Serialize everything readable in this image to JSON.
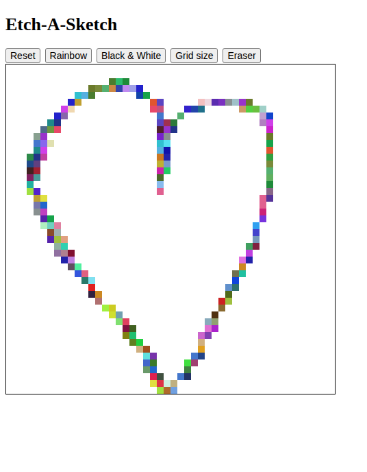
{
  "title": "Etch-A-Sketch",
  "buttons": [
    {
      "label": "Reset"
    },
    {
      "label": "Rainbow"
    },
    {
      "label": "Black & White"
    },
    {
      "label": "Grid size"
    },
    {
      "label": "Eraser"
    }
  ],
  "grid": {
    "cells": [
      [
        2,
        15,
        "#4a7c2f"
      ],
      [
        2,
        16,
        "#2dbb6e"
      ],
      [
        2,
        17,
        "#1f8a3a"
      ],
      [
        3,
        12,
        "#6b7a2a"
      ],
      [
        3,
        13,
        "#7a8a3a"
      ],
      [
        3,
        14,
        "#55b070"
      ],
      [
        3,
        15,
        "#cc8844"
      ],
      [
        3,
        16,
        "#3344aa"
      ],
      [
        3,
        17,
        "#c08af0"
      ],
      [
        3,
        18,
        "#a0a0e8"
      ],
      [
        3,
        19,
        "#2222cc"
      ],
      [
        4,
        10,
        "#30c0d0"
      ],
      [
        4,
        11,
        "#56b0e0"
      ],
      [
        4,
        12,
        "#4a7c2f"
      ],
      [
        4,
        19,
        "#1144aa"
      ],
      [
        4,
        20,
        "#16a34a"
      ],
      [
        5,
        9,
        "#2222cc"
      ],
      [
        5,
        10,
        "#c0a030"
      ],
      [
        5,
        21,
        "#e05530"
      ],
      [
        5,
        22,
        "#5b45c2"
      ],
      [
        5,
        28,
        "#f4c0c0"
      ],
      [
        5,
        29,
        "#f0d8e0"
      ],
      [
        5,
        30,
        "#5b2cb0"
      ],
      [
        5,
        31,
        "#7a30c0"
      ],
      [
        5,
        32,
        "#889090"
      ],
      [
        5,
        33,
        "#a0c0c8"
      ],
      [
        5,
        34,
        "#9933cc"
      ],
      [
        5,
        35,
        "#6b7a2a"
      ],
      [
        6,
        8,
        "#d040e8"
      ],
      [
        6,
        9,
        "#f0d8b0"
      ],
      [
        6,
        21,
        "#e84868"
      ],
      [
        6,
        22,
        "#c45080"
      ],
      [
        6,
        26,
        "#3322cc"
      ],
      [
        6,
        27,
        "#2244aa"
      ],
      [
        6,
        28,
        "#1f6f8a"
      ],
      [
        6,
        34,
        "#cc9966"
      ],
      [
        6,
        35,
        "#55d040"
      ],
      [
        6,
        36,
        "#6ac040"
      ],
      [
        6,
        37,
        "#a0d0c8"
      ],
      [
        7,
        7,
        "#2222cc"
      ],
      [
        7,
        8,
        "#8866aa"
      ],
      [
        7,
        22,
        "#4477cc"
      ],
      [
        7,
        25,
        "#55b070"
      ],
      [
        7,
        37,
        "#c0a0d0"
      ],
      [
        7,
        38,
        "#1144cc"
      ],
      [
        8,
        6,
        "#1f8a8a"
      ],
      [
        8,
        7,
        "#223388"
      ],
      [
        8,
        22,
        "#5b45c2"
      ],
      [
        8,
        23,
        "#a03050"
      ],
      [
        8,
        24,
        "#2d7a3a"
      ],
      [
        8,
        37,
        "#b080c0"
      ],
      [
        8,
        38,
        "#d040e8"
      ],
      [
        9,
        5,
        "#506a8a"
      ],
      [
        9,
        6,
        "#6b9a40"
      ],
      [
        9,
        7,
        "#e84868"
      ],
      [
        9,
        22,
        "#502030"
      ],
      [
        9,
        23,
        "#9933cc"
      ],
      [
        9,
        24,
        "#223388"
      ],
      [
        9,
        38,
        "#cc22cc"
      ],
      [
        10,
        4,
        "#88a090"
      ],
      [
        10,
        5,
        "#9933cc"
      ],
      [
        10,
        22,
        "#7722cc"
      ],
      [
        10,
        23,
        "#889090"
      ],
      [
        10,
        38,
        "#6b7a2a"
      ],
      [
        11,
        4,
        "#4477cc"
      ],
      [
        11,
        5,
        "#8866ee"
      ],
      [
        11,
        6,
        "#e0e0b0"
      ],
      [
        11,
        22,
        "#30c0d0"
      ],
      [
        11,
        23,
        "#56e0f0"
      ],
      [
        11,
        38,
        "#16a34a"
      ],
      [
        12,
        4,
        "#1f8a8a"
      ],
      [
        12,
        5,
        "#d040e8"
      ],
      [
        12,
        22,
        "#56b0e0"
      ],
      [
        12,
        23,
        "#1111aa"
      ],
      [
        12,
        38,
        "#e05530"
      ],
      [
        13,
        3,
        "#2d8a4a"
      ],
      [
        13,
        4,
        "#223388"
      ],
      [
        13,
        5,
        "#c040a0"
      ],
      [
        13,
        22,
        "#cc7722"
      ],
      [
        13,
        23,
        "#2222aa"
      ],
      [
        13,
        38,
        "#30a040"
      ],
      [
        14,
        3,
        "#1f4a8a"
      ],
      [
        14,
        4,
        "#604080"
      ],
      [
        14,
        22,
        "#c0b030"
      ],
      [
        14,
        23,
        "#7799cc"
      ],
      [
        14,
        38,
        "#7a8a3a"
      ],
      [
        15,
        3,
        "#402020"
      ],
      [
        15,
        4,
        "#a02030"
      ],
      [
        15,
        22,
        "#cc22aa"
      ],
      [
        15,
        23,
        "#22cc66"
      ],
      [
        15,
        38,
        "#55b070"
      ],
      [
        16,
        3,
        "#802060"
      ],
      [
        16,
        4,
        "#4a9a9a"
      ],
      [
        16,
        22,
        "#4a6a2a"
      ],
      [
        16,
        38,
        "#60b060"
      ],
      [
        17,
        3,
        "#20b0a0"
      ],
      [
        17,
        22,
        "#88bbee"
      ],
      [
        17,
        38,
        "#1f8a3a"
      ],
      [
        18,
        3,
        "#a0e040"
      ],
      [
        18,
        4,
        "#5522cc"
      ],
      [
        18,
        22,
        "#e06090"
      ],
      [
        18,
        38,
        "#886688"
      ],
      [
        19,
        4,
        "#c0a030"
      ],
      [
        19,
        5,
        "#e0e040"
      ],
      [
        19,
        37,
        "#e06090"
      ],
      [
        19,
        38,
        "#553399"
      ],
      [
        20,
        4,
        "#7777aa"
      ],
      [
        20,
        5,
        "#2266cc"
      ],
      [
        20,
        37,
        "#e06090"
      ],
      [
        21,
        4,
        "#889090"
      ],
      [
        21,
        5,
        "#c040c0"
      ],
      [
        21,
        37,
        "#cc2277"
      ],
      [
        22,
        5,
        "#5522aa"
      ],
      [
        22,
        6,
        "#16a34a"
      ],
      [
        22,
        37,
        "#7733dd"
      ],
      [
        23,
        5,
        "#b0f0c0"
      ],
      [
        23,
        6,
        "#70d0c0"
      ],
      [
        23,
        7,
        "#e080a0"
      ],
      [
        23,
        36,
        "#30a0f0"
      ],
      [
        24,
        6,
        "#8a4a2a"
      ],
      [
        24,
        7,
        "#a0b0b0"
      ],
      [
        24,
        36,
        "#4444cc"
      ],
      [
        25,
        6,
        "#5522aa"
      ],
      [
        25,
        7,
        "#a0c040"
      ],
      [
        25,
        8,
        "#e0a080"
      ],
      [
        25,
        36,
        "#7799bb"
      ],
      [
        26,
        7,
        "#90b0a0"
      ],
      [
        26,
        8,
        "#30d0b0"
      ],
      [
        26,
        35,
        "#40a060"
      ],
      [
        26,
        36,
        "#802040"
      ],
      [
        27,
        7,
        "#9070a0"
      ],
      [
        27,
        8,
        "#b08090"
      ],
      [
        27,
        9,
        "#801030"
      ],
      [
        27,
        35,
        "#c040e0"
      ],
      [
        28,
        8,
        "#2222aa"
      ],
      [
        28,
        9,
        "#c080e0"
      ],
      [
        28,
        34,
        "#e070e0"
      ],
      [
        28,
        35,
        "#2222aa"
      ],
      [
        29,
        9,
        "#605060"
      ],
      [
        29,
        10,
        "#50f0a0"
      ],
      [
        29,
        34,
        "#cc8822"
      ],
      [
        30,
        10,
        "#3355dd"
      ],
      [
        30,
        11,
        "#e06080"
      ],
      [
        30,
        33,
        "#707050"
      ],
      [
        30,
        34,
        "#20c0a0"
      ],
      [
        31,
        11,
        "#2a7a6a"
      ],
      [
        31,
        12,
        "#80e0f0"
      ],
      [
        31,
        33,
        "#1144dd"
      ],
      [
        32,
        12,
        "#e02020"
      ],
      [
        32,
        32,
        "#6090cc"
      ],
      [
        32,
        33,
        "#307070"
      ],
      [
        33,
        12,
        "#302040"
      ],
      [
        33,
        13,
        "#cc8822"
      ],
      [
        33,
        32,
        "#506a1a"
      ],
      [
        34,
        13,
        "#b07070"
      ],
      [
        34,
        31,
        "#cc2222"
      ],
      [
        34,
        32,
        "#a0c040"
      ],
      [
        35,
        14,
        "#a0f040"
      ],
      [
        35,
        15,
        "#cccc22"
      ],
      [
        35,
        31,
        "#8a6a30"
      ],
      [
        36,
        15,
        "#d0e030"
      ],
      [
        36,
        16,
        "#70a0b0"
      ],
      [
        36,
        30,
        "#503010"
      ],
      [
        37,
        16,
        "#80e070"
      ],
      [
        37,
        17,
        "#e04060"
      ],
      [
        37,
        29,
        "#88aabb"
      ],
      [
        37,
        30,
        "#90a070"
      ],
      [
        38,
        17,
        "#801040"
      ],
      [
        38,
        18,
        "#406020"
      ],
      [
        38,
        29,
        "#e070d0"
      ],
      [
        38,
        30,
        "#aa22cc"
      ],
      [
        39,
        17,
        "#808010"
      ],
      [
        39,
        18,
        "#20c070"
      ],
      [
        39,
        28,
        "#cc66cc"
      ],
      [
        39,
        29,
        "#8040b0"
      ],
      [
        40,
        18,
        "#608020"
      ],
      [
        40,
        19,
        "#20d040"
      ],
      [
        40,
        28,
        "#d0b080"
      ],
      [
        41,
        19,
        "#d0b080"
      ],
      [
        41,
        20,
        "#a05020"
      ],
      [
        41,
        28,
        "#e0a020"
      ],
      [
        42,
        20,
        "#60e0e0"
      ],
      [
        42,
        21,
        "#7733aa"
      ],
      [
        42,
        27,
        "#4477cc"
      ],
      [
        42,
        28,
        "#224488"
      ],
      [
        43,
        20,
        "#4466cc"
      ],
      [
        43,
        21,
        "#3a7a2a"
      ],
      [
        43,
        26,
        "#40e040"
      ],
      [
        43,
        27,
        "#a04070"
      ],
      [
        44,
        20,
        "#6a9a6a"
      ],
      [
        44,
        21,
        "#2266cc"
      ],
      [
        44,
        26,
        "#408040"
      ],
      [
        45,
        21,
        "#e02050"
      ],
      [
        45,
        22,
        "#405040"
      ],
      [
        45,
        25,
        "#4477cc"
      ],
      [
        45,
        26,
        "#223366"
      ],
      [
        46,
        21,
        "#e0e040"
      ],
      [
        46,
        22,
        "#dd3344"
      ],
      [
        46,
        23,
        "#d0f0e0"
      ],
      [
        46,
        24,
        "#c0b080"
      ],
      [
        47,
        22,
        "#a0e040"
      ],
      [
        47,
        23,
        "#b06a2a"
      ],
      [
        47,
        24,
        "#70a0e0"
      ]
    ]
  }
}
